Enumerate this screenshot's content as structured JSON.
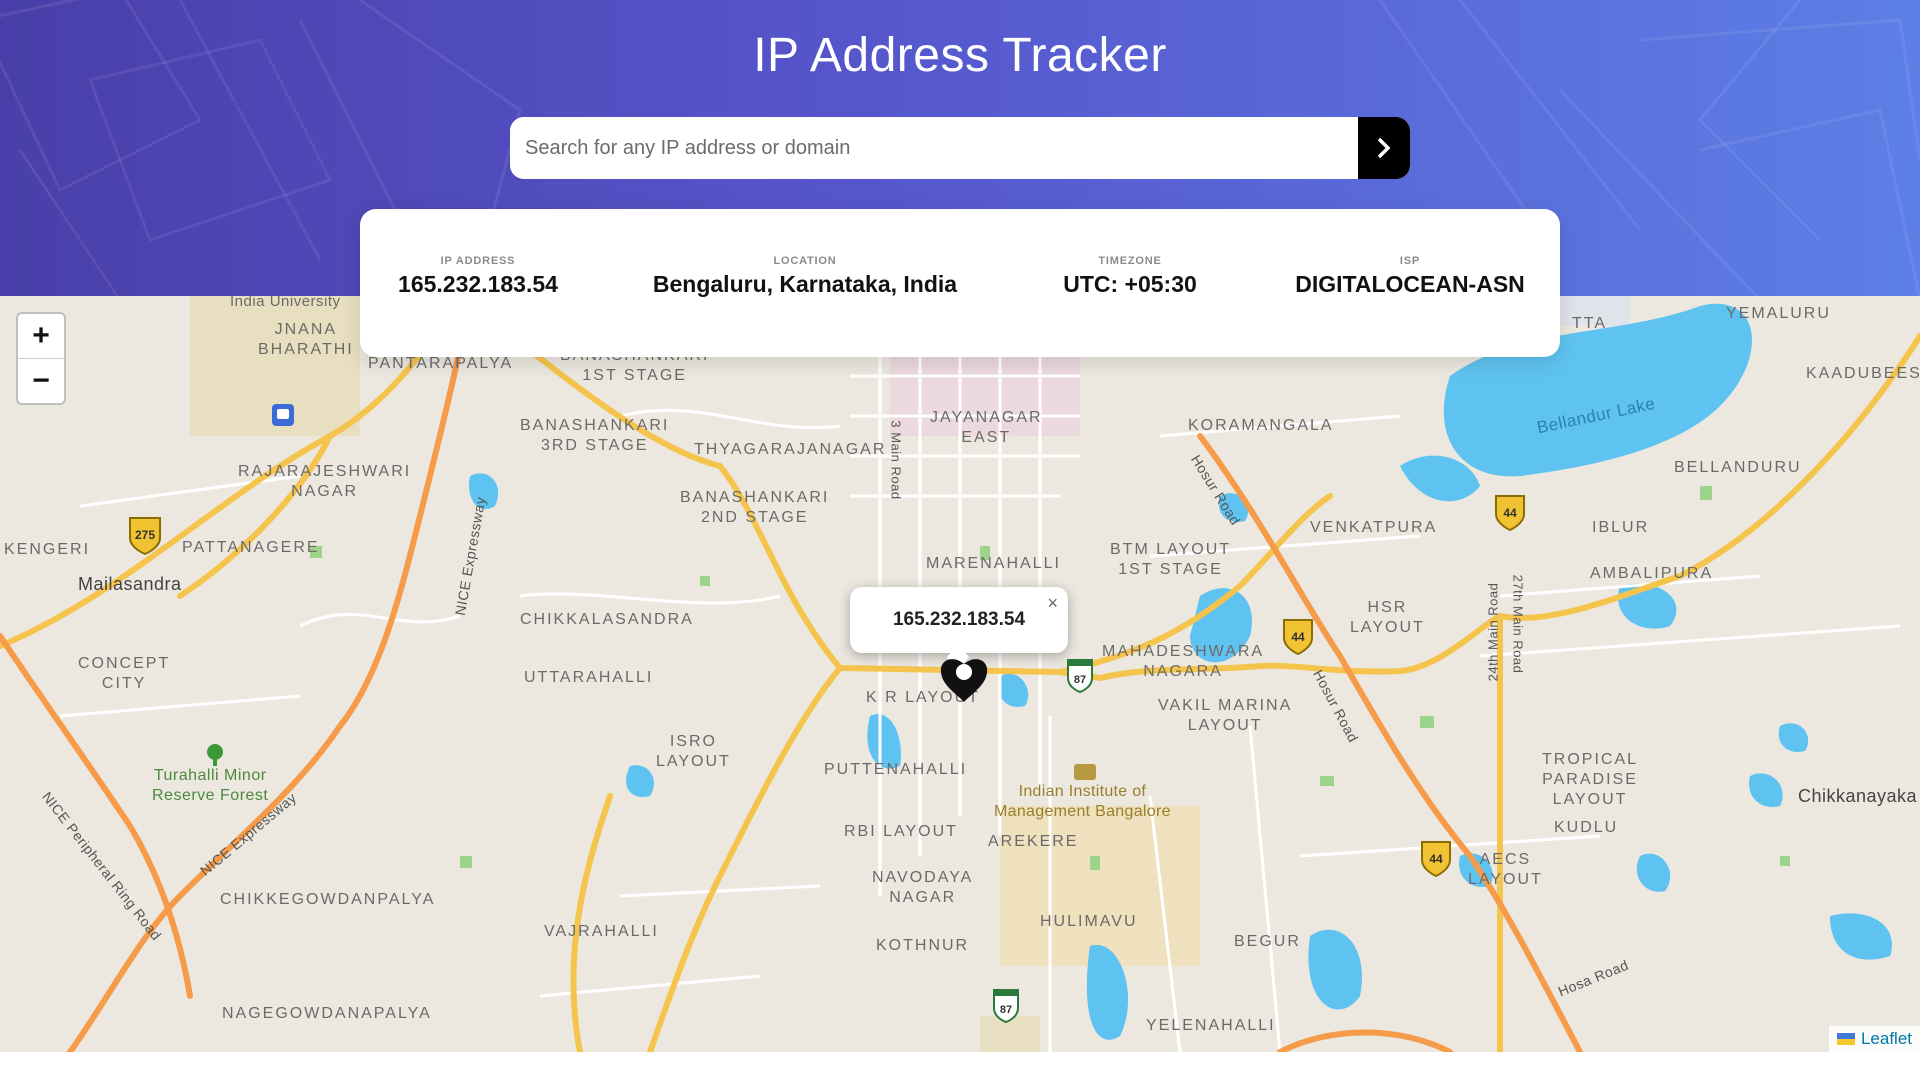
{
  "app": {
    "title": "IP Address Tracker"
  },
  "search": {
    "placeholder": "Search for any IP address or domain",
    "value": ""
  },
  "info": {
    "ip_label": "IP ADDRESS",
    "ip_value": "165.232.183.54",
    "location_label": "LOCATION",
    "location_value": "Bengaluru, Karnataka, India",
    "timezone_label": "TIMEZONE",
    "timezone_value": "UTC: +05:30",
    "isp_label": "ISP",
    "isp_value": "DIGITALOCEAN-ASN"
  },
  "map": {
    "zoom_in": "+",
    "zoom_out": "−",
    "popup_text": "165.232.183.54",
    "popup_close": "×",
    "attribution": "Leaflet",
    "labels": {
      "l1": "JNANA\nBHARATHI",
      "l2": "PANTARAPALYA",
      "l3": "BANASHANKARI\n1ST STAGE",
      "l4": "JAYANAGAR\nEAST",
      "l5": "KORAMANGALA",
      "l6": "YEMALURU",
      "l7": "KAADUBEES",
      "l8": "BANASHANKARI\n3RD STAGE",
      "l9": "THYAGARAJANAGAR",
      "l10": "RAJARAJESHWARI\nNAGAR",
      "l11": "BELLANDURU",
      "l12": "BANASHANKARI\n2ND STAGE",
      "l13": "KENGERI",
      "l14": "PATTANAGERE",
      "l15": "VENKATPURA",
      "l16": "IBLUR",
      "l17": "MARENAHALLI",
      "l18": "BTM LAYOUT\n1ST STAGE",
      "l19": "AMBALIPURA",
      "l20": "Mailasandra",
      "l21": "CHIKKALASANDRA",
      "l22": "HSR\nLAYOUT",
      "l23": "CONCEPT\nCITY",
      "l24": "MAHADESHWARA\nNAGARA",
      "l25": "UTTARAHALLI",
      "l26": "K R LAYOUT",
      "l27": "VAKIL MARINA\nLAYOUT",
      "l28": "ISRO\nLAYOUT",
      "l29": "PUTTENAHALLI",
      "l30": "TROPICAL\nPARADISE\nLAYOUT",
      "l31": "Turahalli Minor\nReserve Forest",
      "l32": "Indian Institute of\nManagement Bangalore",
      "l33": "Chikkanayaka",
      "l34": "RBI LAYOUT",
      "l35": "AREKERE",
      "l36": "KUDLU",
      "l37": "AECS\nLAYOUT",
      "l38": "NAVODAYA\nNAGAR",
      "l39": "CHIKKEGOWDANPALYA",
      "l40": "HULIMAVU",
      "l41": "VAJRAHALLI",
      "l42": "KOTHNUR",
      "l43": "BEGUR",
      "l44": "NAGEGOWDANAPALYA",
      "l45": "YELENAHALLI",
      "l46": "Bellandur Lake",
      "l47": "India University",
      "l48": "NICE Expressway",
      "l49": "NICE Expressway",
      "l50": "NICE Peripheral Ring Road",
      "l51": "Hosur Road",
      "l52": "Hosur Road",
      "l53": "3 Main Road",
      "l54": "24th Main Road",
      "l55": "27th Main Road",
      "l56": "Hosa Road",
      "l57": "TTA"
    },
    "shields": {
      "s1": "275",
      "s2": "44",
      "s3": "44",
      "s4": "44",
      "s5": "87",
      "s6": "87"
    }
  },
  "colors": {
    "gradient_start": "#4a3fa9",
    "gradient_end": "#5d7fe6",
    "water": "#5ec3f0",
    "road_major": "#f5c44d",
    "road_express": "#f59b4a"
  }
}
